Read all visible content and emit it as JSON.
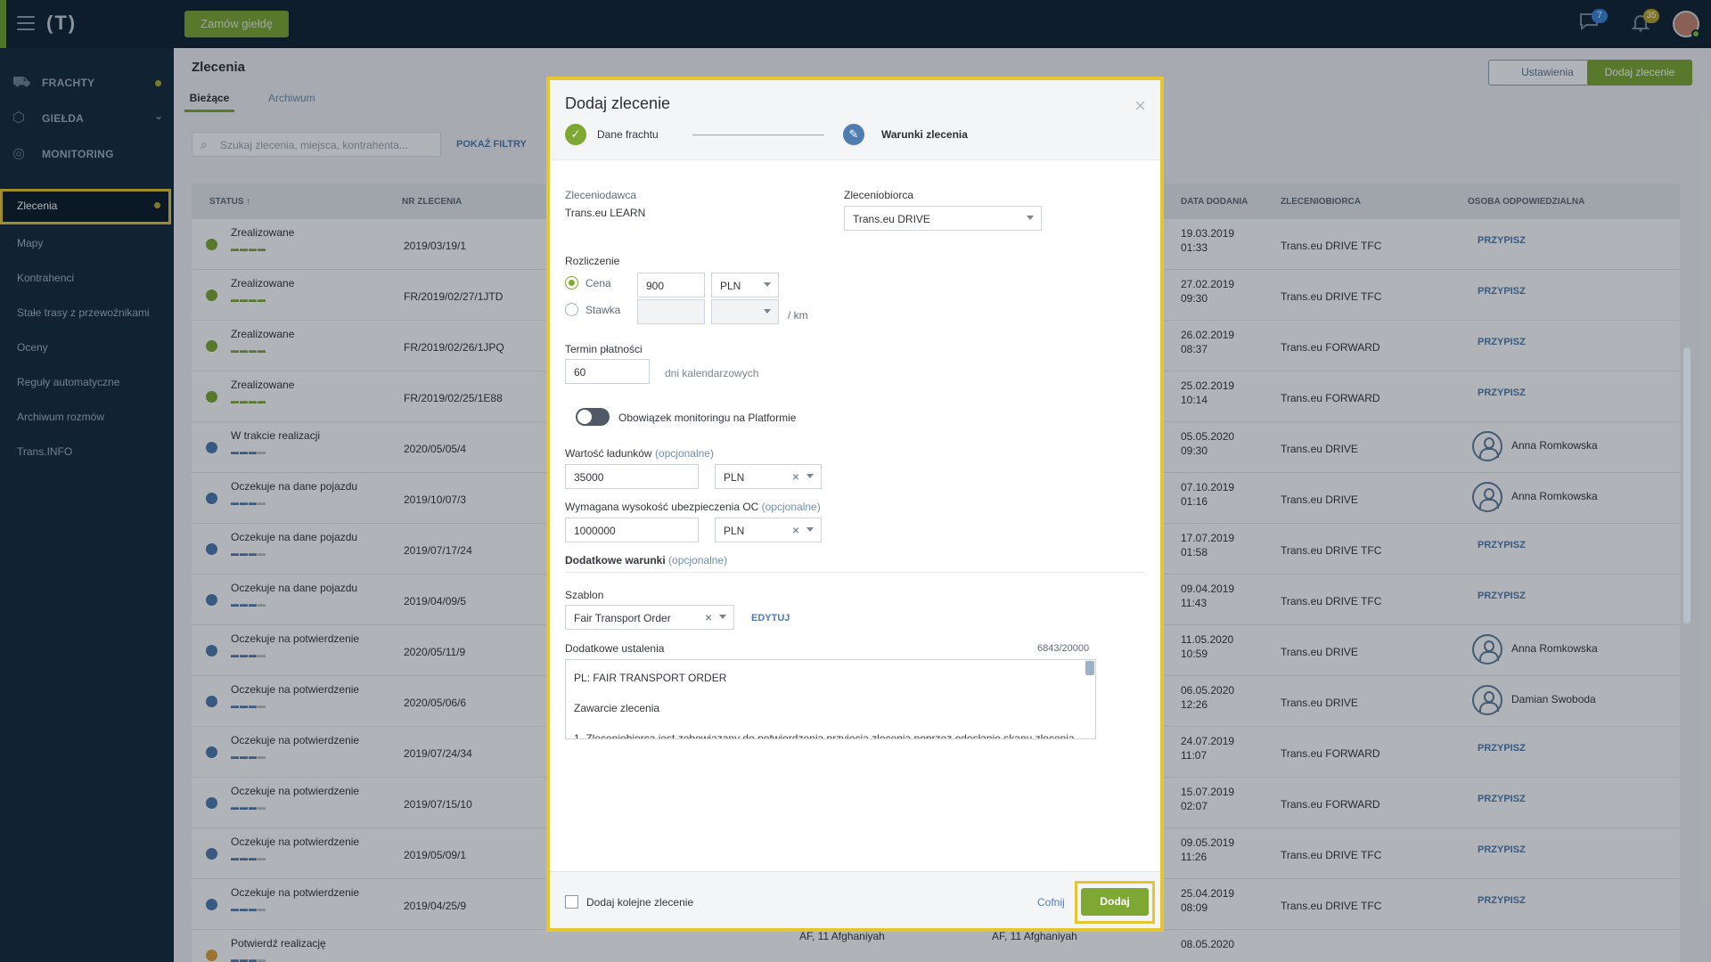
{
  "topbar": {
    "logo": "(T)",
    "order_button": "Zamów giełdę",
    "messages_badge": "7",
    "notifications_badge": "35"
  },
  "sidebar": {
    "sections": [
      {
        "label": "FRACHTY",
        "icon": "freight-icon"
      },
      {
        "label": "GIEŁDA",
        "icon": "exchange-icon"
      },
      {
        "label": "MONITORING",
        "icon": "monitoring-icon"
      }
    ],
    "items": [
      {
        "label": "Zlecenia",
        "active": true
      },
      {
        "label": "Mapy"
      },
      {
        "label": "Kontrahenci"
      },
      {
        "label": "Stałe trasy z przewoźnikami"
      },
      {
        "label": "Oceny"
      },
      {
        "label": "Reguły automatyczne"
      },
      {
        "label": "Archiwum rozmów"
      },
      {
        "label": "Trans.INFO"
      }
    ]
  },
  "main": {
    "title": "Zlecenia",
    "tabs": [
      "Bieżące",
      "Archiwum"
    ],
    "settings_button": "Ustawienia",
    "add_button": "Dodaj zlecenie",
    "search_placeholder": "Szukaj zlecenia, miejsca, kontrahenta...",
    "filters_link": "POKAŻ FILTRY",
    "columns": [
      "STATUS ↑",
      "NR ZLECENIA",
      "DATA DODANIA",
      "ZLECENIOBIORCA",
      "OSOBA ODPOWIEDZIALNA"
    ],
    "rows": [
      {
        "status": "Zrealizowane",
        "kind": "done",
        "nr": "2019/03/19/1",
        "date1": "19.03.2019",
        "date2": "01:33",
        "zleceniobiorca": "Trans.eu DRIVE TFC",
        "osoba": "PRZYPISZ"
      },
      {
        "status": "Zrealizowane",
        "kind": "done",
        "nr": "FR/2019/02/27/1JTD",
        "date1": "27.02.2019",
        "date2": "09:30",
        "zleceniobiorca": "Trans.eu DRIVE TFC",
        "osoba": "PRZYPISZ"
      },
      {
        "status": "Zrealizowane",
        "kind": "done",
        "nr": "FR/2019/02/26/1JPQ",
        "date1": "26.02.2019",
        "date2": "08:37",
        "zleceniobiorca": "Trans.eu FORWARD",
        "osoba": "PRZYPISZ"
      },
      {
        "status": "Zrealizowane",
        "kind": "done",
        "nr": "FR/2019/02/25/1E88",
        "date1": "25.02.2019",
        "date2": "10:14",
        "zleceniobiorca": "Trans.eu FORWARD",
        "osoba": "PRZYPISZ"
      },
      {
        "status": "W trakcie realizacji",
        "kind": "progress",
        "nr": "2020/05/05/4",
        "date1": "05.05.2020",
        "date2": "09:30",
        "zleceniobiorca": "Trans.eu DRIVE",
        "person": "Anna Romkowska"
      },
      {
        "status": "Oczekuje na dane pojazdu",
        "kind": "wait",
        "nr": "2019/10/07/3",
        "date1": "07.10.2019",
        "date2": "01:16",
        "zleceniobiorca": "Trans.eu DRIVE",
        "person": "Anna Romkowska"
      },
      {
        "status": "Oczekuje na dane pojazdu",
        "kind": "wait",
        "nr": "2019/07/17/24",
        "date1": "17.07.2019",
        "date2": "01:58",
        "zleceniobiorca": "Trans.eu DRIVE TFC",
        "osoba": "PRZYPISZ"
      },
      {
        "status": "Oczekuje na dane pojazdu",
        "kind": "wait",
        "nr": "2019/04/09/5",
        "date1": "09.04.2019",
        "date2": "11:43",
        "zleceniobiorca": "Trans.eu DRIVE TFC",
        "osoba": "PRZYPISZ"
      },
      {
        "status": "Oczekuje na potwierdzenie",
        "kind": "wait",
        "nr": "2020/05/11/9",
        "date1": "11.05.2020",
        "date2": "10:59",
        "zleceniobiorca": "Trans.eu DRIVE",
        "person": "Anna Romkowska"
      },
      {
        "status": "Oczekuje na potwierdzenie",
        "kind": "wait",
        "nr": "2020/05/06/6",
        "date1": "06.05.2020",
        "date2": "12:26",
        "zleceniobiorca": "Trans.eu DRIVE",
        "person": "Damian Swoboda"
      },
      {
        "status": "Oczekuje na potwierdzenie",
        "kind": "wait",
        "nr": "2019/07/24/34",
        "date1": "24.07.2019",
        "date2": "11:07",
        "zleceniobiorca": "Trans.eu FORWARD",
        "osoba": "PRZYPISZ"
      },
      {
        "status": "Oczekuje na potwierdzenie",
        "kind": "wait",
        "nr": "2019/07/15/10",
        "date1": "15.07.2019",
        "date2": "02:07",
        "zleceniobiorca": "Trans.eu FORWARD",
        "osoba": "PRZYPISZ"
      },
      {
        "status": "Oczekuje na potwierdzenie",
        "kind": "wait",
        "nr": "2019/05/09/1",
        "date1": "09.05.2019",
        "date2": "11:26",
        "zleceniobiorca": "Trans.eu DRIVE TFC",
        "osoba": "PRZYPISZ"
      },
      {
        "status": "Oczekuje na potwierdzenie",
        "kind": "wait",
        "nr": "2019/04/25/9",
        "date1": "25.04.2019",
        "date2": "08:09",
        "zleceniobiorca": "Trans.eu DRIVE TFC",
        "osoba": "PRZYPISZ"
      },
      {
        "status": "Potwierdź realizację",
        "kind": "confirm",
        "nr": "",
        "date1": "08.05.2020",
        "date2": "",
        "zleceniobiorca": "",
        "flag1": "AF, 11 Afghaniyah",
        "flag2": "AF, 11 Afghaniyah"
      }
    ]
  },
  "modal": {
    "title": "Dodaj zlecenie",
    "step1": "Dane frachtu",
    "step2": "Warunki zlecenia",
    "zleceniodawca_label": "Zleceniodawca",
    "zleceniodawca_value": "Trans.eu LEARN",
    "zleceniobiorca_label": "Zleceniobiorca",
    "zleceniobiorca_value": "Trans.eu DRIVE",
    "rozliczenie_label": "Rozliczenie",
    "cena_label": "Cena",
    "cena_value": "900",
    "cena_currency": "PLN",
    "stawka_label": "Stawka",
    "per_km": "/ km",
    "termin_label": "Termin płatności",
    "termin_value": "60",
    "termin_unit": "dni kalendarzowych",
    "monitoring_label": "Obowiązek monitoringu na Platformie",
    "wartosc_label": "Wartość ładunków",
    "optional": "(opcjonalne)",
    "wartosc_value": "35000",
    "wartosc_currency": "PLN",
    "ubezp_label": "Wymagana wysokość ubezpieczenia OC",
    "ubezp_value": "1000000",
    "ubezp_currency": "PLN",
    "dodatkowe_label": "Dodatkowe warunki",
    "szablon_label": "Szablon",
    "szablon_value": "Fair Transport Order",
    "edytuj": "EDYTUJ",
    "ustalenia_label": "Dodatkowe ustalenia",
    "counter": "6843/20000",
    "text_line1": "PL: FAIR TRANSPORT ORDER",
    "text_line2": "Zawarcie zlecenia",
    "text_line3": "1. Zleceniobiorca jest zobowiązany do potwierdzenia przyjęcia zlecenia poprzez odesłanie skanu zlecenia",
    "checkbox_label": "Dodaj kolejne zlecenie",
    "back_button": "Cofnij",
    "submit_button": "Dodaj"
  },
  "colors": {
    "accent_green": "#7ea833",
    "highlight_yellow": "#e6c630",
    "link_blue": "#4f7db0",
    "sidebar": "#152a3c"
  }
}
